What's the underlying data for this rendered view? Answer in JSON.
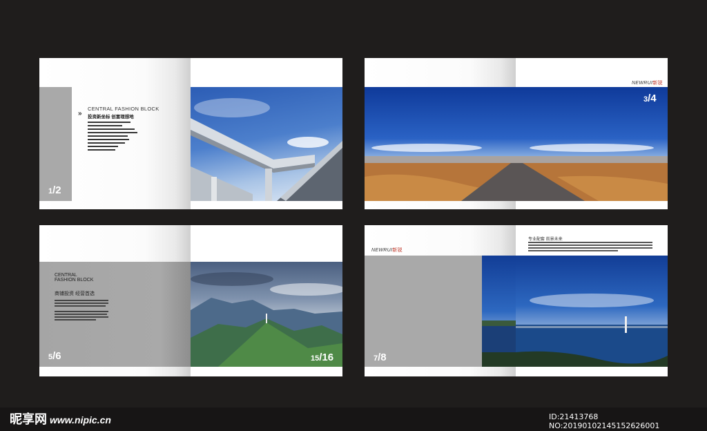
{
  "spread1": {
    "heading": "CENTRAL FASHION BLOCK",
    "subheading": "投资新坐标  创富理想地",
    "page_left_a": "1",
    "page_left_b": "2"
  },
  "spread2": {
    "brand": "NEWRUI",
    "brand_cn": "新锐",
    "page_a": "3",
    "page_b": "4"
  },
  "spread3": {
    "heading_line1": "CENTRAL",
    "heading_line2": "FASHION BLOCK",
    "subheading": "商铺投资  经营首选",
    "page_left_a": "5",
    "page_left_b": "6",
    "page_right_a": "15",
    "page_right_b": "16"
  },
  "spread4": {
    "brand": "NEWRUI",
    "brand_cn": "新锐",
    "title": "专业配套  前景未来",
    "page_a": "7",
    "page_b": "8"
  },
  "watermark": {
    "logo": "昵享网",
    "url": "www.nipic.cn",
    "id": "ID:21413768 NO:20190102145152626001"
  },
  "colors": {
    "background": "#1f1d1c",
    "gray_panel": "#a9a9a9",
    "sky": "#1e4fa8"
  }
}
